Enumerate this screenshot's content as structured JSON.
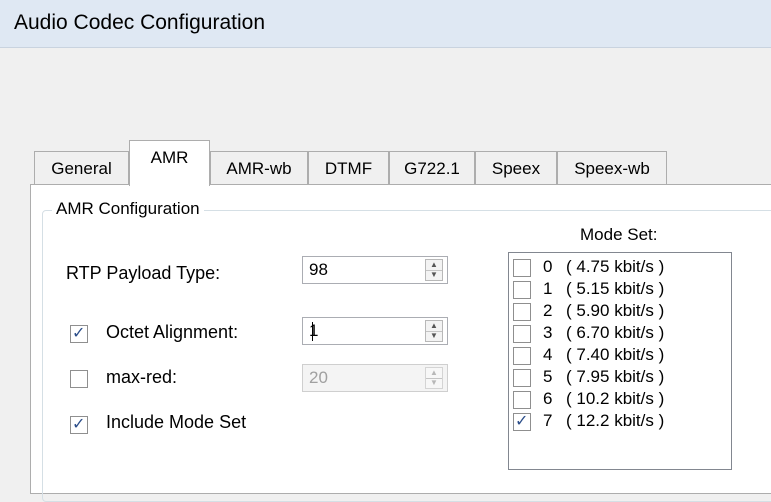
{
  "window": {
    "title": "Audio Codec Configuration"
  },
  "tabs": [
    "General",
    "AMR",
    "AMR-wb",
    "DTMF",
    "G722.1",
    "Speex",
    "Speex-wb"
  ],
  "active_tab": "AMR",
  "group": {
    "title": "AMR Configuration"
  },
  "fields": {
    "rtp_payload_label": "RTP Payload Type:",
    "rtp_payload_value": "98",
    "octet_alignment_label": "Octet Alignment:",
    "octet_alignment_value": "1",
    "octet_alignment_checked": true,
    "max_red_label": "max-red:",
    "max_red_value": "20",
    "max_red_checked": false,
    "include_mode_set_label": "Include Mode Set",
    "include_mode_set_checked": true
  },
  "mode_set": {
    "title": "Mode Set:",
    "modes": [
      {
        "num": "0",
        "rate": "( 4.75 kbit/s )",
        "checked": false
      },
      {
        "num": "1",
        "rate": "( 5.15 kbit/s )",
        "checked": false
      },
      {
        "num": "2",
        "rate": "( 5.90 kbit/s )",
        "checked": false
      },
      {
        "num": "3",
        "rate": "( 6.70 kbit/s )",
        "checked": false
      },
      {
        "num": "4",
        "rate": "( 7.40 kbit/s )",
        "checked": false
      },
      {
        "num": "5",
        "rate": "( 7.95 kbit/s )",
        "checked": false
      },
      {
        "num": "6",
        "rate": "( 10.2 kbit/s )",
        "checked": false
      },
      {
        "num": "7",
        "rate": "( 12.2 kbit/s )",
        "checked": true
      }
    ]
  }
}
